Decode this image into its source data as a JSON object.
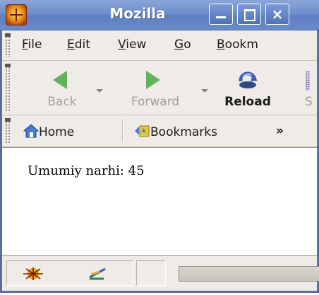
{
  "window": {
    "title": "Mozilla",
    "close_glyph": "×"
  },
  "menubar": {
    "items": [
      {
        "label": "File",
        "accel": "F",
        "rest": "ile"
      },
      {
        "label": "Edit",
        "accel": "E",
        "rest": "dit"
      },
      {
        "label": "View",
        "accel": "V",
        "rest": "iew"
      },
      {
        "label": "Go",
        "accel": "G",
        "rest": "o"
      },
      {
        "label": "Bookm",
        "accel": "B",
        "rest": "ookm"
      }
    ]
  },
  "navbar": {
    "back_label": "Back",
    "forward_label": "Forward",
    "reload_label": "Reload",
    "stop_label": "S"
  },
  "personalbar": {
    "home_label": "Home",
    "bookmarks_label": "Bookmarks",
    "overflow_glyph": "»"
  },
  "content": {
    "text": "Umumiy narhi: 45"
  },
  "colors": {
    "titlebar": "#6f8fcb",
    "chrome": "#efebe7",
    "nav_arrow": "#5fb35a"
  }
}
